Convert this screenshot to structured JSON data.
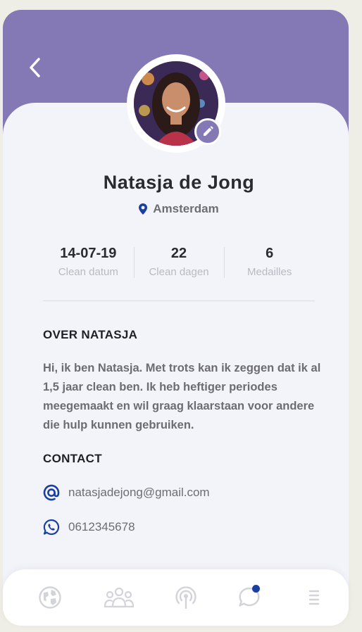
{
  "profile": {
    "name": "Natasja de Jong",
    "location": "Amsterdam"
  },
  "stats": [
    {
      "value": "14-07-19",
      "label": "Clean datum"
    },
    {
      "value": "22",
      "label": "Clean dagen"
    },
    {
      "value": "6",
      "label": "Medailles"
    }
  ],
  "about": {
    "title": "OVER NATASJA",
    "text": "Hi, ik ben Natasja. Met trots kan ik zeggen dat ik al 1,5 jaar clean ben.  Ik heb heftiger periodes meegemaakt en wil graag klaarstaan voor andere die hulp kunnen gebruiken."
  },
  "contact": {
    "title": "CONTACT",
    "email": "natasjadejong@gmail.com",
    "phone": "0612345678"
  },
  "icons": {
    "back": "chevron-left-icon",
    "edit": "pencil-icon",
    "location": "map-pin-icon",
    "email": "at-icon",
    "phone": "whatsapp-icon",
    "tabs": [
      "globe-icon",
      "group-icon",
      "broadcast-icon",
      "chat-icon",
      "menu-icon"
    ]
  },
  "colors": {
    "header": "#8479b4",
    "accent": "#1a3fa0",
    "notification_dot": "#1a3fa0"
  }
}
